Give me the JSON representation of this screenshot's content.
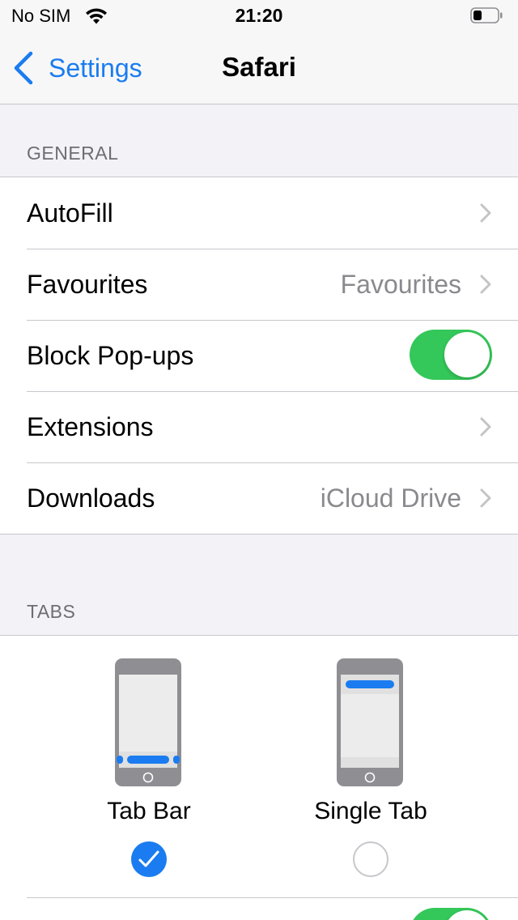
{
  "status_bar": {
    "carrier": "No SIM",
    "time": "21:20"
  },
  "nav": {
    "back_label": "Settings",
    "title": "Safari"
  },
  "general": {
    "header": "GENERAL",
    "rows": [
      {
        "label": "AutoFill",
        "value": ""
      },
      {
        "label": "Favourites",
        "value": "Favourites"
      },
      {
        "label": "Block Pop-ups",
        "toggle": true
      },
      {
        "label": "Extensions",
        "value": ""
      },
      {
        "label": "Downloads",
        "value": "iCloud Drive"
      }
    ]
  },
  "tabs": {
    "header": "TABS",
    "options": [
      {
        "label": "Tab Bar",
        "selected": true
      },
      {
        "label": "Single Tab",
        "selected": false
      }
    ]
  },
  "colors": {
    "accent": "#1a7cf0",
    "toggle_on": "#34c759",
    "background": "#f2f2f7"
  },
  "icons": {
    "back": "chevron-left-icon",
    "disclosure": "chevron-right-icon",
    "wifi": "wifi-icon",
    "battery": "battery-icon",
    "check": "checkmark-icon"
  }
}
